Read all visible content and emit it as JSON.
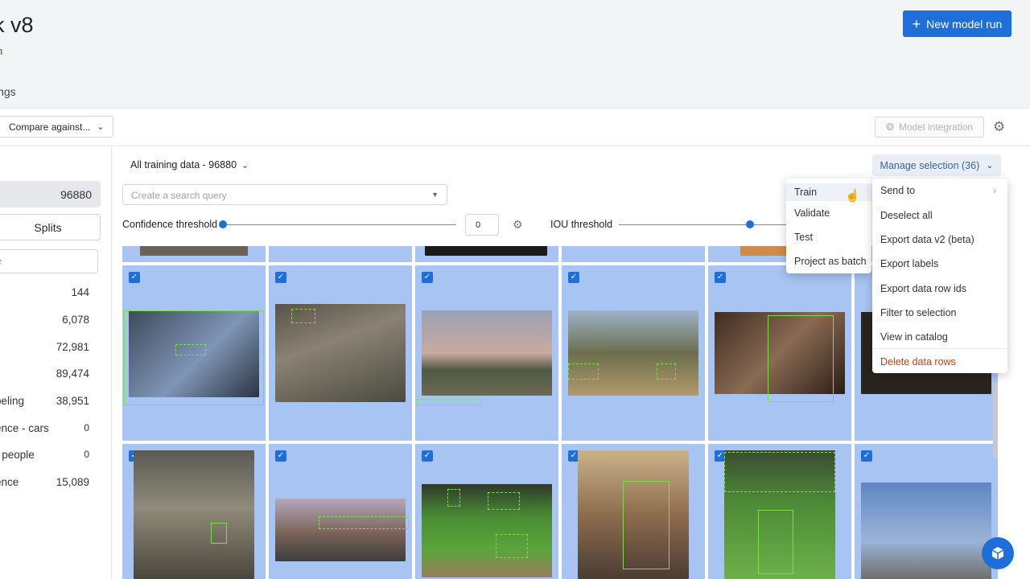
{
  "header": {
    "title": "k v8",
    "subtitle": "n",
    "tab_fragment": "ings",
    "new_run_label": "New model run"
  },
  "toolbar": {
    "compare_label": "Compare against...",
    "model_integration_label": "Model integration"
  },
  "sidebar": {
    "all_count": "96880",
    "splits_label": "Splits",
    "search_placeholder": "e",
    "rows": [
      {
        "label": "",
        "count": "144"
      },
      {
        "label": "",
        "count": "6,078"
      },
      {
        "label": "",
        "count": "72,981"
      },
      {
        "label": "",
        "count": "89,474"
      },
      {
        "label": "peling",
        "count": "38,951"
      },
      {
        "label": "ence - cars",
        "count": "0"
      },
      {
        "label": "- people",
        "count": "0"
      },
      {
        "label": "ence",
        "count": "15,089"
      }
    ]
  },
  "main": {
    "dataset_label": "All training data - 96880",
    "search_placeholder": "Create a search query",
    "confidence_label": "Confidence threshold",
    "confidence_value": "0",
    "iou_label": "IOU threshold",
    "manage_label": "Manage selection (36)"
  },
  "send_menu": {
    "items": [
      "Train",
      "Validate",
      "Test",
      "Project as batch"
    ]
  },
  "manage_menu": {
    "send_to": "Send to",
    "items": [
      "Deselect all",
      "Export data v2 (beta)",
      "Export labels",
      "Export data row ids",
      "Filter to selection",
      "View in catalog"
    ],
    "danger": "Delete data rows"
  },
  "colors": {
    "accent": "#1e6fd9",
    "selected_cell": "#a8c4f2",
    "bbox": "#7ae04a",
    "danger": "#c2410c"
  }
}
